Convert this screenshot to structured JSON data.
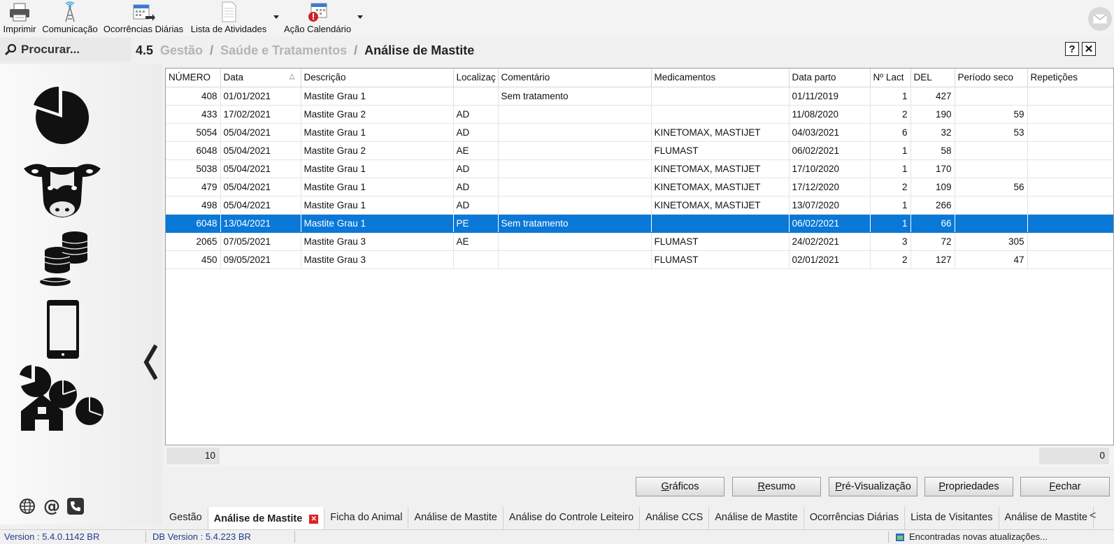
{
  "toolbar": {
    "items": [
      {
        "label": "Imprimir",
        "icon": "printer-icon"
      },
      {
        "label": "Comunicação",
        "icon": "antenna-icon"
      },
      {
        "label": "Ocorrências Diárias",
        "icon": "calendar-arrow-icon"
      },
      {
        "label": "Lista de Atividades",
        "icon": "document-list-icon"
      },
      {
        "label": "Ação Calendário",
        "icon": "calendar-alert-icon"
      }
    ]
  },
  "search": {
    "label": "Procurar..."
  },
  "breadcrumb": {
    "number": "4.5",
    "level1": "Gestão",
    "level2": "Saúde e Tratamentos",
    "current": "Análise de Mastite",
    "sep": "/"
  },
  "header_buttons": {
    "help": "?",
    "close": "✕"
  },
  "grid": {
    "columns": [
      "NÚMERO",
      "Data",
      "Descrição",
      "Localizaç",
      "Comentário",
      "Medicamentos",
      "Data parto",
      "Nº Lact",
      "DEL",
      "Período seco",
      "Repetições"
    ],
    "rows": [
      [
        "408",
        "01/01/2021",
        "Mastite Grau 1",
        "",
        "Sem tratamento",
        "",
        "01/11/2019",
        "1",
        "427",
        "",
        ""
      ],
      [
        "433",
        "17/02/2021",
        "Mastite Grau 2",
        "AD",
        "",
        "",
        "11/08/2020",
        "2",
        "190",
        "59",
        ""
      ],
      [
        "5054",
        "05/04/2021",
        "Mastite Grau 1",
        "AD",
        "",
        "KINETOMAX, MASTIJET",
        "04/03/2021",
        "6",
        "32",
        "53",
        ""
      ],
      [
        "6048",
        "05/04/2021",
        "Mastite Grau 2",
        "AE",
        "",
        "FLUMAST",
        "06/02/2021",
        "1",
        "58",
        "",
        ""
      ],
      [
        "5038",
        "05/04/2021",
        "Mastite Grau 1",
        "AD",
        "",
        "KINETOMAX, MASTIJET",
        "17/10/2020",
        "1",
        "170",
        "",
        ""
      ],
      [
        "479",
        "05/04/2021",
        "Mastite Grau 1",
        "AD",
        "",
        "KINETOMAX, MASTIJET",
        "17/12/2020",
        "2",
        "109",
        "56",
        ""
      ],
      [
        "498",
        "05/04/2021",
        "Mastite Grau 1",
        "AD",
        "",
        "KINETOMAX, MASTIJET",
        "13/07/2020",
        "1",
        "266",
        "",
        ""
      ],
      [
        "6048",
        "13/04/2021",
        "Mastite Grau 1",
        "PE",
        "Sem tratamento",
        "",
        "06/02/2021",
        "1",
        "66",
        "",
        ""
      ],
      [
        "2065",
        "07/05/2021",
        "Mastite Grau 3",
        "AE",
        "",
        "FLUMAST",
        "24/02/2021",
        "3",
        "72",
        "305",
        ""
      ],
      [
        "450",
        "09/05/2021",
        "Mastite Grau 3",
        "",
        "",
        "FLUMAST",
        "02/01/2021",
        "2",
        "127",
        "47",
        ""
      ]
    ],
    "selected_row": 7,
    "footer_count": "10",
    "footer_total": "0"
  },
  "buttons": {
    "graficos": {
      "first": "G",
      "rest": "ráficos"
    },
    "resumo": {
      "first": "R",
      "rest": "esumo"
    },
    "previsualizacao": {
      "first": "P",
      "rest": "ré-Visualização"
    },
    "propriedades": {
      "first": "P",
      "rest": "ropriedades"
    },
    "fechar": {
      "first": "F",
      "rest": "echar"
    }
  },
  "tabs": [
    "Gestão",
    "Análise de Mastite",
    "Ficha do Animal",
    "Análise de Mastite",
    "Análise do Controle Leiteiro",
    "Análise CCS",
    "Análise de Mastite",
    "Ocorrências Diárias",
    "Lista de Visitantes",
    "Análise de Mastite"
  ],
  "active_tab": 1,
  "status": {
    "version": "Version :  5.4.0.1142 BR",
    "db_version": "DB Version :  5.4.223 BR",
    "update": "Encontradas novas atualizações..."
  },
  "colors": {
    "selection": "#0a78d7",
    "accent_red": "#d22222"
  }
}
